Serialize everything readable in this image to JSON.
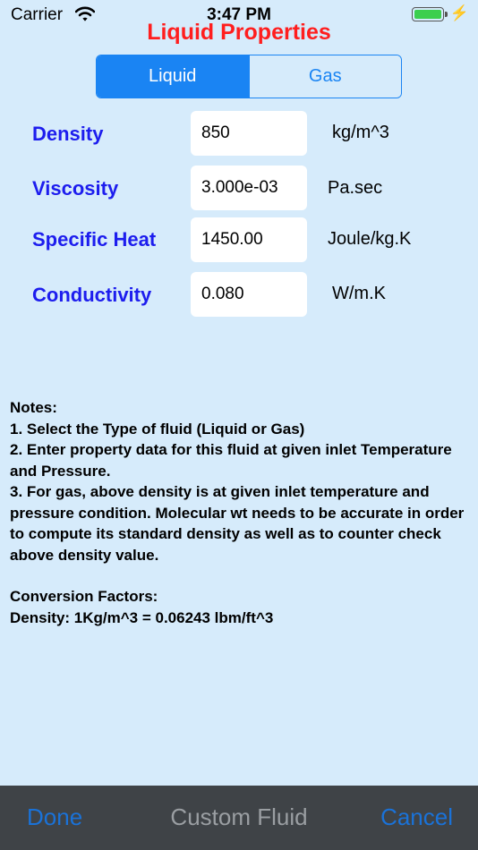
{
  "status_bar": {
    "carrier": "Carrier",
    "time": "3:47 PM",
    "charge_symbol": "⚡"
  },
  "title": "Liquid Properties",
  "segment": {
    "liquid": "Liquid",
    "gas": "Gas",
    "selected": "Liquid"
  },
  "properties": [
    {
      "label": "Density",
      "value": "850",
      "unit": "kg/m^3"
    },
    {
      "label": "Viscosity",
      "value": "3.000e-03",
      "unit": "Pa.sec"
    },
    {
      "label": "Specific Heat",
      "value": "1450.00",
      "unit": "Joule/kg.K"
    },
    {
      "label": "Conductivity",
      "value": "0.080",
      "unit": "W/m.K"
    }
  ],
  "notes": {
    "heading": "Notes:",
    "items": [
      "1. Select the Type of fluid (Liquid or Gas)",
      "2. Enter property data for this fluid at given inlet Temperature and Pressure.",
      "3. For gas, above density is at given inlet temperature and pressure condition. Molecular wt needs to be accurate in order to compute its standard density as well as to counter check above density value."
    ],
    "conversion_heading": "Conversion Factors:",
    "conversion_line": "Density: 1Kg/m^3 = 0.06243 lbm/ft^3"
  },
  "toolbar": {
    "done": "Done",
    "title": "Custom Fluid",
    "cancel": "Cancel"
  },
  "colors": {
    "background": "#d6ebfb",
    "accent": "#1a84f3",
    "title": "#ff1e1e",
    "label": "#1d1dee",
    "toolbar": "#3f4347"
  }
}
